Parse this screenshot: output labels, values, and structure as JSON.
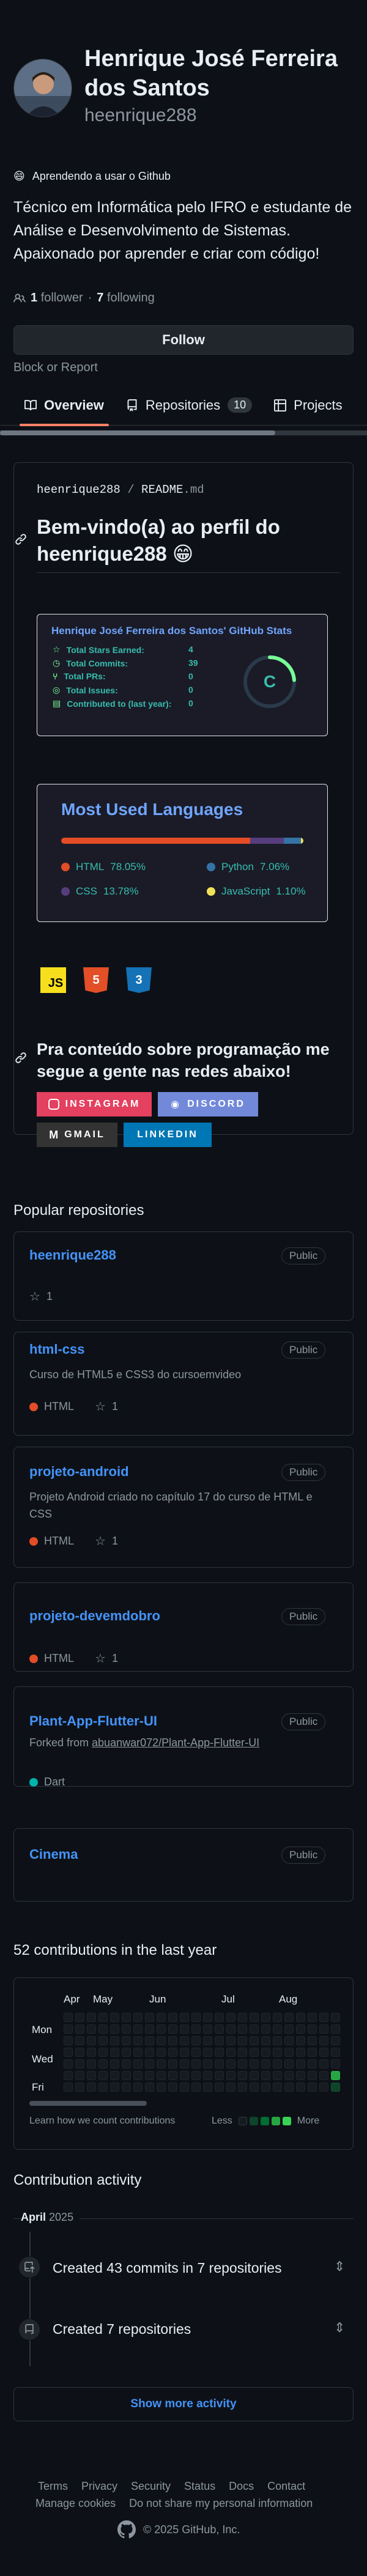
{
  "profile": {
    "name": "Henrique José Ferreira dos Santos",
    "login": "heenrique288",
    "status_emoji": "😄",
    "status_text": "Aprendendo a usar o Github",
    "bio": "Técnico em Informática pelo IFRO e estudante de Análise e Desenvolvimento de Sistemas. Apaixonado por aprender e criar com código!",
    "followers_count": "1",
    "followers_label": "follower",
    "separator": "·",
    "following_count": "7",
    "following_label": "following",
    "follow_label": "Follow",
    "block_label": "Block or Report"
  },
  "tabs": [
    {
      "label": "Overview",
      "active": true
    },
    {
      "label": "Repositories",
      "count": "10"
    },
    {
      "label": "Projects"
    }
  ],
  "readme": {
    "path_user": "heenrique288",
    "path_sep": "/",
    "path_file": "README",
    "path_ext": ".md",
    "heading": "Bem-vindo(a) ao perfil do heenrique288 😁",
    "stats": {
      "title": "Henrique José Ferreira dos Santos' GitHub Stats",
      "rows": [
        {
          "label": "Total Stars Earned:",
          "value": "4"
        },
        {
          "label": "Total Commits:",
          "value": "39"
        },
        {
          "label": "Total PRs:",
          "value": "0"
        },
        {
          "label": "Total Issues:",
          "value": "0"
        },
        {
          "label": "Contributed to (last year):",
          "value": "0"
        }
      ],
      "grade": "C"
    },
    "languages": {
      "title": "Most Used Languages",
      "items": [
        {
          "name": "HTML",
          "percent": "78.05%",
          "value": 78.05,
          "color": "#e34c26"
        },
        {
          "name": "Python",
          "percent": "7.06%",
          "value": 7.06,
          "color": "#3572A5"
        },
        {
          "name": "CSS",
          "percent": "13.78%",
          "value": 13.78,
          "color": "#563d7c"
        },
        {
          "name": "JavaScript",
          "percent": "1.10%",
          "value": 1.1,
          "color": "#f1e05a"
        }
      ]
    },
    "tech_icons": [
      {
        "label": "JS",
        "color": "#f7df1e",
        "text_color": "#000000"
      },
      {
        "label": "5",
        "color": "#e34f26",
        "text_color": "#ffffff"
      },
      {
        "label": "3",
        "color": "#1572b6",
        "text_color": "#ffffff"
      }
    ],
    "social_heading": "Pra conteúdo sobre programação me segue a gente nas redes abaixo!",
    "social": [
      {
        "label": "INSTAGRAM",
        "color": "#e4405f"
      },
      {
        "label": "DISCORD",
        "color": "#7289da"
      },
      {
        "label": "GMAIL",
        "color": "#333333"
      },
      {
        "label": "LINKEDIN",
        "color": "#0077b5"
      }
    ]
  },
  "popular": {
    "title": "Popular repositories",
    "public_label": "Public",
    "repos": [
      {
        "name": "heenrique288",
        "desc": "",
        "lang": "",
        "stars": "1"
      },
      {
        "name": "html-css",
        "desc": "Curso de HTML5 e CSS3 do cursoemvideo",
        "lang": "HTML",
        "lang_color": "#e34c26",
        "stars": "1"
      },
      {
        "name": "projeto-android",
        "desc": "Projeto Android criado no capítulo 17 do curso de HTML e CSS",
        "lang": "HTML",
        "lang_color": "#e34c26",
        "stars": "1"
      },
      {
        "name": "projeto-devemdobro",
        "desc": "",
        "lang": "HTML",
        "lang_color": "#e34c26",
        "stars": "1"
      },
      {
        "name": "Plant-App-Flutter-UI",
        "forked_prefix": "Forked from ",
        "forked": "abuanwar072/Plant-App-Flutter-UI",
        "lang": "Dart",
        "lang_color": "#00B4AB",
        "stars": ""
      },
      {
        "name": "Cinema",
        "desc": "",
        "lang": "",
        "stars": ""
      }
    ]
  },
  "contributions": {
    "title": "52 contributions in the last year",
    "months": [
      "Apr",
      "May",
      "Jun",
      "Jul",
      "Aug"
    ],
    "days": [
      "Mon",
      "Wed",
      "Fri"
    ],
    "learn": "Learn how we count contributions",
    "less": "Less",
    "more": "More"
  },
  "activity": {
    "title": "Contribution activity",
    "month": "April",
    "year": "2025",
    "items": [
      {
        "text": "Created 43 commits in 7 repositories"
      },
      {
        "text": "Created 7 repositories"
      }
    ],
    "show_more": "Show more activity"
  },
  "footer": {
    "links1": [
      "Terms",
      "Privacy",
      "Security",
      "Status",
      "Docs",
      "Contact"
    ],
    "links2": [
      "Manage cookies",
      "Do not share my personal information"
    ],
    "copyright": "© 2025 GitHub, Inc."
  }
}
